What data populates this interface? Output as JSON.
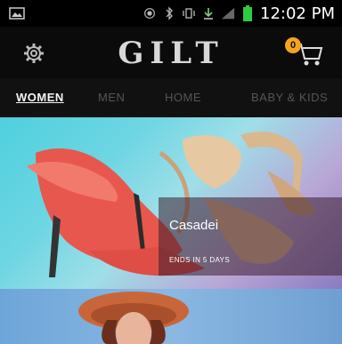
{
  "status_bar": {
    "time": "12:02 PM",
    "icons": [
      "image-icon",
      "wifi-icon",
      "bluetooth-icon",
      "vibrate-icon",
      "download-icon",
      "signal-icon",
      "battery-icon"
    ]
  },
  "header": {
    "logo": "GILT",
    "cart_count": "0",
    "icons": [
      "settings-icon",
      "cart-icon"
    ]
  },
  "tabs": [
    {
      "label": "WOMEN",
      "active": true
    },
    {
      "label": "MEN",
      "active": false
    },
    {
      "label": "HOME",
      "active": false
    },
    {
      "label": "BABY & KIDS",
      "active": false
    }
  ],
  "sale": {
    "brand": "Casadei",
    "ends": "ENDS IN 5 DAYS"
  },
  "colors": {
    "badge": "#f4a51c",
    "hero_start": "#4fd0de",
    "hero_end": "#8b7bc0"
  }
}
